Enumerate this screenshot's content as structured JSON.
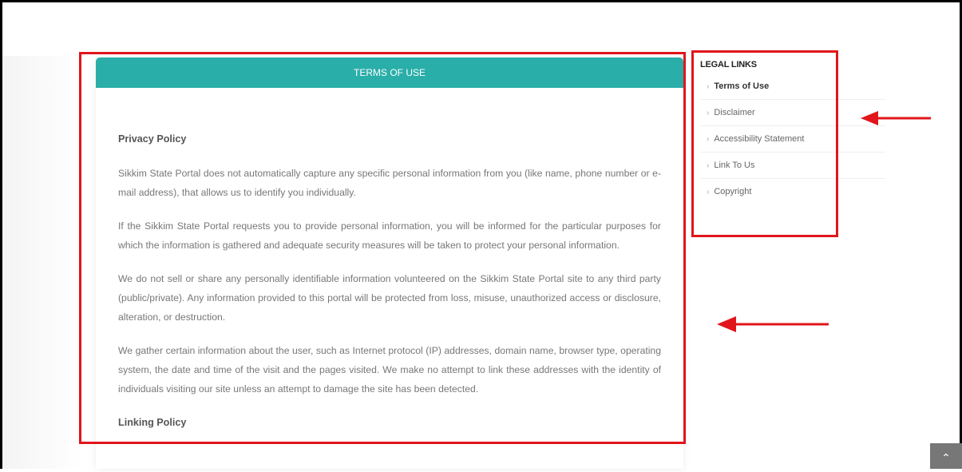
{
  "content": {
    "header": "TERMS OF USE",
    "privacy_heading": "Privacy Policy",
    "paragraphs": [
      "Sikkim State Portal does not automatically capture any specific personal information from you (like name, phone number or e-mail address), that allows us to identify you individually.",
      "If the Sikkim State Portal requests you to provide personal information, you will be informed for the particular purposes for which the information is gathered and adequate security measures will be taken to protect your personal information.",
      "We do not sell or share any personally identifiable information volunteered on the Sikkim State Portal site to any third party (public/private). Any information provided to this portal will be protected from loss, misuse, unauthorized access or disclosure, alteration, or destruction.",
      "We gather certain information about the user, such as Internet protocol (IP) addresses, domain name, browser type, operating system, the date and time of the visit and the pages visited. We make no attempt to link these addresses with the identity of individuals visiting our site unless an attempt to damage the site has been detected."
    ],
    "linking_heading": "Linking Policy"
  },
  "sidebar": {
    "title": "LEGAL LINKS",
    "items": [
      {
        "label": "Terms of Use",
        "active": true
      },
      {
        "label": "Disclaimer",
        "active": false
      },
      {
        "label": "Accessibility Statement",
        "active": false
      },
      {
        "label": "Link To Us",
        "active": false
      },
      {
        "label": "Copyright",
        "active": false
      }
    ]
  },
  "icons": {
    "chevron": "chevron-right-icon",
    "scroll_top": "chevron-up-icon",
    "annotation_arrow": "arrow-left-icon"
  },
  "colors": {
    "header_bg": "#2aaea9",
    "highlight": "#e1151b",
    "scroll_button": "#777777"
  }
}
